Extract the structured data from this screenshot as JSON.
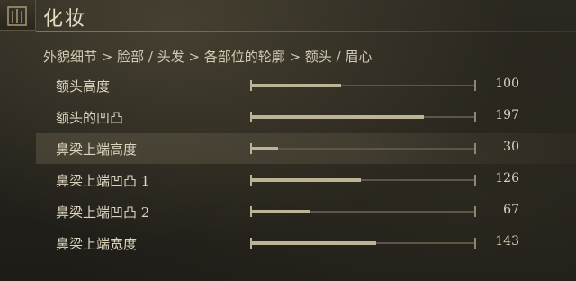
{
  "header": {
    "title": "化妆"
  },
  "breadcrumb": "外貌细节 > 脸部 / 头发 > 各部位的轮廓 > 额头 / 眉心",
  "sliders": [
    {
      "label": "额头高度",
      "value": "100",
      "fraction": 0.4
    },
    {
      "label": "额头的凹凸",
      "value": "197",
      "fraction": 0.77
    },
    {
      "label": "鼻梁上端高度",
      "value": "30",
      "fraction": 0.12
    },
    {
      "label": "鼻梁上端凹凸 1",
      "value": "126",
      "fraction": 0.49
    },
    {
      "label": "鼻梁上端凹凸 2",
      "value": "67",
      "fraction": 0.26
    },
    {
      "label": "鼻梁上端宽度",
      "value": "143",
      "fraction": 0.56
    }
  ],
  "highlighted_index": 2,
  "colors": {
    "fill": "#bdb497",
    "track": "#5c5647",
    "text": "#dcd4bf"
  }
}
